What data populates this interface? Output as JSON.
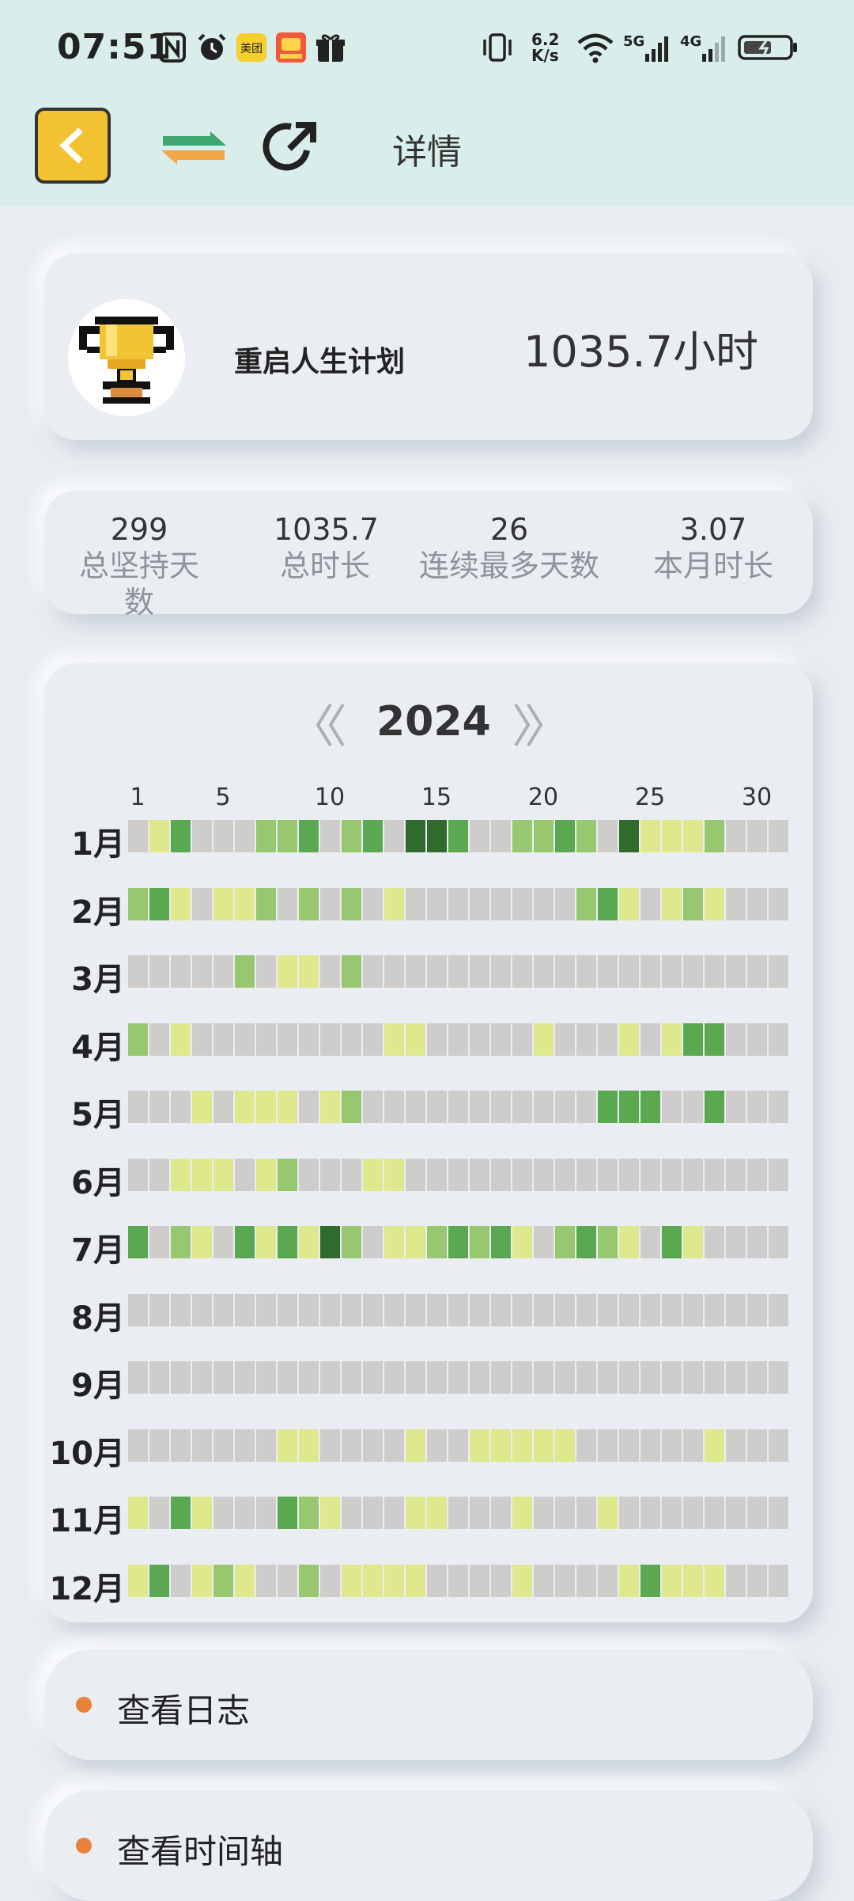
{
  "status_bar": {
    "time": "07:51",
    "net_speed": "6.2 K/s",
    "icons": [
      "nfc-icon",
      "alarm-icon",
      "meituan-app-icon",
      "app-icon",
      "gift-icon",
      "vibrate-icon",
      "wifi-icon",
      "signal-5g-icon",
      "signal-4g-icon",
      "battery-icon"
    ]
  },
  "header": {
    "title": "详情",
    "back_icon": "chevron-left-icon",
    "swap_icon": "swap-arrows-icon",
    "share_icon": "share-arrow-icon"
  },
  "plan": {
    "name": "重启人生计划",
    "total": "1035.7小时",
    "avatar_icon": "trophy-icon"
  },
  "stats": [
    {
      "value": "299",
      "label": "总坚持天数"
    },
    {
      "value": "1035.7",
      "label": "总时长"
    },
    {
      "value": "26",
      "label": "连续最多天数"
    },
    {
      "value": "3.07",
      "label": "本月时长"
    }
  ],
  "calendar": {
    "year": "2024",
    "day_labels": [
      "1",
      "5",
      "10",
      "15",
      "20",
      "25",
      "30"
    ],
    "months": [
      "1月",
      "2月",
      "3月",
      "4月",
      "5月",
      "6月",
      "7月",
      "8月",
      "9月",
      "10月",
      "11月",
      "12月"
    ],
    "colors": [
      "#cfcccc",
      "#dde98c",
      "#97c76e",
      "#5aa850",
      "#2e6b2c"
    ],
    "intensity": [
      "0130002230230443002232041112",
      "2310112020201000000002310121",
      "0000020110200000000000000000",
      "2010000000001100000100010133",
      "0001011101200000000000333003",
      "0011101200011000000000000000",
      "3021031314201123231023210310",
      "0000000000000000000000000000",
      "0000000000000000000000000000",
      "0000000110000100111110000001",
      "1031000321000110001000100000",
      "1301210020111100001000013111"
    ]
  },
  "actions": [
    {
      "label": "查看日志"
    },
    {
      "label": "查看时间轴"
    }
  ]
}
